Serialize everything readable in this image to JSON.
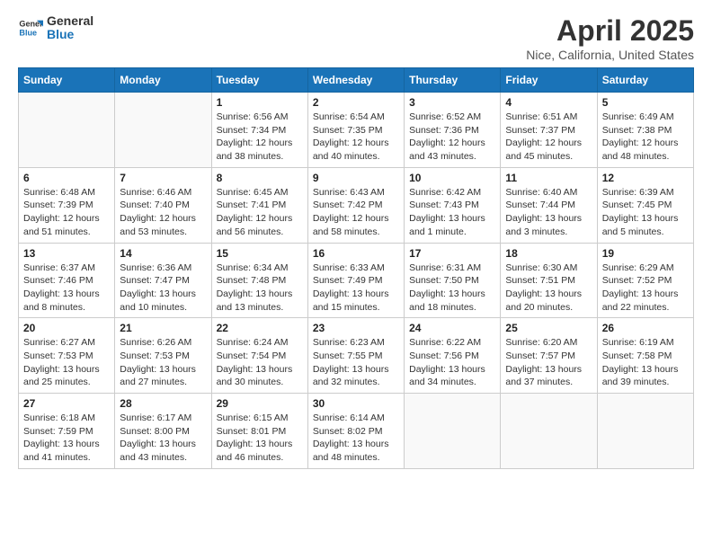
{
  "logo": {
    "line1": "General",
    "line2": "Blue"
  },
  "title": "April 2025",
  "location": "Nice, California, United States",
  "days_of_week": [
    "Sunday",
    "Monday",
    "Tuesday",
    "Wednesday",
    "Thursday",
    "Friday",
    "Saturday"
  ],
  "weeks": [
    [
      {
        "day": "",
        "info": ""
      },
      {
        "day": "",
        "info": ""
      },
      {
        "day": "1",
        "info": "Sunrise: 6:56 AM\nSunset: 7:34 PM\nDaylight: 12 hours and 38 minutes."
      },
      {
        "day": "2",
        "info": "Sunrise: 6:54 AM\nSunset: 7:35 PM\nDaylight: 12 hours and 40 minutes."
      },
      {
        "day": "3",
        "info": "Sunrise: 6:52 AM\nSunset: 7:36 PM\nDaylight: 12 hours and 43 minutes."
      },
      {
        "day": "4",
        "info": "Sunrise: 6:51 AM\nSunset: 7:37 PM\nDaylight: 12 hours and 45 minutes."
      },
      {
        "day": "5",
        "info": "Sunrise: 6:49 AM\nSunset: 7:38 PM\nDaylight: 12 hours and 48 minutes."
      }
    ],
    [
      {
        "day": "6",
        "info": "Sunrise: 6:48 AM\nSunset: 7:39 PM\nDaylight: 12 hours and 51 minutes."
      },
      {
        "day": "7",
        "info": "Sunrise: 6:46 AM\nSunset: 7:40 PM\nDaylight: 12 hours and 53 minutes."
      },
      {
        "day": "8",
        "info": "Sunrise: 6:45 AM\nSunset: 7:41 PM\nDaylight: 12 hours and 56 minutes."
      },
      {
        "day": "9",
        "info": "Sunrise: 6:43 AM\nSunset: 7:42 PM\nDaylight: 12 hours and 58 minutes."
      },
      {
        "day": "10",
        "info": "Sunrise: 6:42 AM\nSunset: 7:43 PM\nDaylight: 13 hours and 1 minute."
      },
      {
        "day": "11",
        "info": "Sunrise: 6:40 AM\nSunset: 7:44 PM\nDaylight: 13 hours and 3 minutes."
      },
      {
        "day": "12",
        "info": "Sunrise: 6:39 AM\nSunset: 7:45 PM\nDaylight: 13 hours and 5 minutes."
      }
    ],
    [
      {
        "day": "13",
        "info": "Sunrise: 6:37 AM\nSunset: 7:46 PM\nDaylight: 13 hours and 8 minutes."
      },
      {
        "day": "14",
        "info": "Sunrise: 6:36 AM\nSunset: 7:47 PM\nDaylight: 13 hours and 10 minutes."
      },
      {
        "day": "15",
        "info": "Sunrise: 6:34 AM\nSunset: 7:48 PM\nDaylight: 13 hours and 13 minutes."
      },
      {
        "day": "16",
        "info": "Sunrise: 6:33 AM\nSunset: 7:49 PM\nDaylight: 13 hours and 15 minutes."
      },
      {
        "day": "17",
        "info": "Sunrise: 6:31 AM\nSunset: 7:50 PM\nDaylight: 13 hours and 18 minutes."
      },
      {
        "day": "18",
        "info": "Sunrise: 6:30 AM\nSunset: 7:51 PM\nDaylight: 13 hours and 20 minutes."
      },
      {
        "day": "19",
        "info": "Sunrise: 6:29 AM\nSunset: 7:52 PM\nDaylight: 13 hours and 22 minutes."
      }
    ],
    [
      {
        "day": "20",
        "info": "Sunrise: 6:27 AM\nSunset: 7:53 PM\nDaylight: 13 hours and 25 minutes."
      },
      {
        "day": "21",
        "info": "Sunrise: 6:26 AM\nSunset: 7:53 PM\nDaylight: 13 hours and 27 minutes."
      },
      {
        "day": "22",
        "info": "Sunrise: 6:24 AM\nSunset: 7:54 PM\nDaylight: 13 hours and 30 minutes."
      },
      {
        "day": "23",
        "info": "Sunrise: 6:23 AM\nSunset: 7:55 PM\nDaylight: 13 hours and 32 minutes."
      },
      {
        "day": "24",
        "info": "Sunrise: 6:22 AM\nSunset: 7:56 PM\nDaylight: 13 hours and 34 minutes."
      },
      {
        "day": "25",
        "info": "Sunrise: 6:20 AM\nSunset: 7:57 PM\nDaylight: 13 hours and 37 minutes."
      },
      {
        "day": "26",
        "info": "Sunrise: 6:19 AM\nSunset: 7:58 PM\nDaylight: 13 hours and 39 minutes."
      }
    ],
    [
      {
        "day": "27",
        "info": "Sunrise: 6:18 AM\nSunset: 7:59 PM\nDaylight: 13 hours and 41 minutes."
      },
      {
        "day": "28",
        "info": "Sunrise: 6:17 AM\nSunset: 8:00 PM\nDaylight: 13 hours and 43 minutes."
      },
      {
        "day": "29",
        "info": "Sunrise: 6:15 AM\nSunset: 8:01 PM\nDaylight: 13 hours and 46 minutes."
      },
      {
        "day": "30",
        "info": "Sunrise: 6:14 AM\nSunset: 8:02 PM\nDaylight: 13 hours and 48 minutes."
      },
      {
        "day": "",
        "info": ""
      },
      {
        "day": "",
        "info": ""
      },
      {
        "day": "",
        "info": ""
      }
    ]
  ]
}
